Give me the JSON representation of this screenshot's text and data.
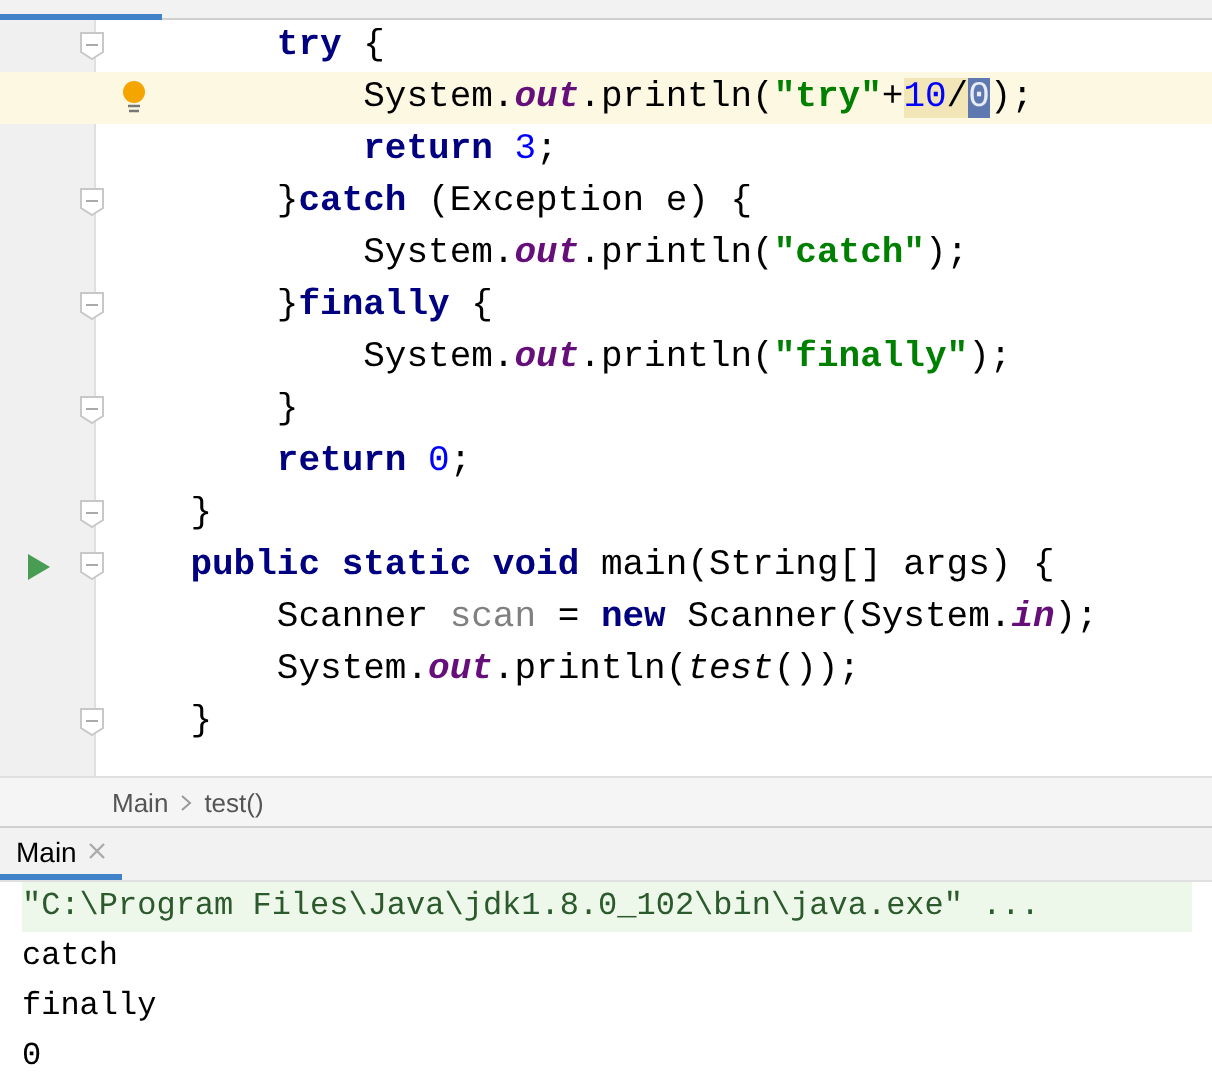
{
  "editor": {
    "lines": [
      {
        "fold": true,
        "current": false,
        "bulb": false,
        "run": false,
        "tokens": [
          {
            "kind": "keyword",
            "text": "        try"
          },
          {
            "kind": "plain",
            "text": " {"
          }
        ]
      },
      {
        "fold": false,
        "current": true,
        "bulb": true,
        "run": false,
        "tokens": [
          {
            "kind": "plain",
            "text": "            System."
          },
          {
            "kind": "field",
            "text": "out"
          },
          {
            "kind": "plain",
            "text": ".println("
          },
          {
            "kind": "string",
            "text": "\"try\""
          },
          {
            "kind": "plain",
            "text": "+"
          },
          {
            "kind": "usagenumber",
            "text": "10"
          },
          {
            "kind": "usageplain",
            "text": "/"
          },
          {
            "kind": "selectednumber",
            "text": "0"
          },
          {
            "kind": "plain",
            "text": ");"
          }
        ]
      },
      {
        "fold": false,
        "current": false,
        "bulb": false,
        "run": false,
        "tokens": [
          {
            "kind": "keyword",
            "text": "            return"
          },
          {
            "kind": "number",
            "text": " 3"
          },
          {
            "kind": "plain",
            "text": ";"
          }
        ]
      },
      {
        "fold": true,
        "current": false,
        "bulb": false,
        "run": false,
        "tokens": [
          {
            "kind": "plain",
            "text": "        }"
          },
          {
            "kind": "keyword",
            "text": "catch"
          },
          {
            "kind": "plain",
            "text": " (Exception e) {"
          }
        ]
      },
      {
        "fold": false,
        "current": false,
        "bulb": false,
        "run": false,
        "tokens": [
          {
            "kind": "plain",
            "text": "            System."
          },
          {
            "kind": "field",
            "text": "out"
          },
          {
            "kind": "plain",
            "text": ".println("
          },
          {
            "kind": "string",
            "text": "\"catch\""
          },
          {
            "kind": "plain",
            "text": ");"
          }
        ]
      },
      {
        "fold": true,
        "current": false,
        "bulb": false,
        "run": false,
        "tokens": [
          {
            "kind": "plain",
            "text": "        }"
          },
          {
            "kind": "keyword",
            "text": "finally"
          },
          {
            "kind": "plain",
            "text": " {"
          }
        ]
      },
      {
        "fold": false,
        "current": false,
        "bulb": false,
        "run": false,
        "tokens": [
          {
            "kind": "plain",
            "text": "            System."
          },
          {
            "kind": "field",
            "text": "out"
          },
          {
            "kind": "plain",
            "text": ".println("
          },
          {
            "kind": "string",
            "text": "\"finally\""
          },
          {
            "kind": "plain",
            "text": ");"
          }
        ]
      },
      {
        "fold": true,
        "current": false,
        "bulb": false,
        "run": false,
        "tokens": [
          {
            "kind": "plain",
            "text": "        }"
          }
        ]
      },
      {
        "fold": false,
        "current": false,
        "bulb": false,
        "run": false,
        "tokens": [
          {
            "kind": "keyword",
            "text": "        return"
          },
          {
            "kind": "number",
            "text": " 0"
          },
          {
            "kind": "plain",
            "text": ";"
          }
        ]
      },
      {
        "fold": true,
        "current": false,
        "bulb": false,
        "run": false,
        "tokens": [
          {
            "kind": "plain",
            "text": "    }"
          }
        ]
      },
      {
        "fold": true,
        "current": false,
        "bulb": false,
        "run": true,
        "tokens": [
          {
            "kind": "keyword",
            "text": "    public static void"
          },
          {
            "kind": "plain",
            "text": " main(String[] args) {"
          }
        ]
      },
      {
        "fold": false,
        "current": false,
        "bulb": false,
        "run": false,
        "tokens": [
          {
            "kind": "plain",
            "text": "        Scanner "
          },
          {
            "kind": "unused",
            "text": "scan"
          },
          {
            "kind": "plain",
            "text": " = "
          },
          {
            "kind": "keyword",
            "text": "new"
          },
          {
            "kind": "plain",
            "text": " Scanner(System."
          },
          {
            "kind": "field",
            "text": "in"
          },
          {
            "kind": "plain",
            "text": ");"
          }
        ]
      },
      {
        "fold": false,
        "current": false,
        "bulb": false,
        "run": false,
        "tokens": [
          {
            "kind": "plain",
            "text": "        System."
          },
          {
            "kind": "field",
            "text": "out"
          },
          {
            "kind": "plain",
            "text": ".println("
          },
          {
            "kind": "call",
            "text": "test"
          },
          {
            "kind": "plain",
            "text": "());"
          }
        ]
      },
      {
        "fold": true,
        "current": false,
        "bulb": false,
        "run": false,
        "tokens": [
          {
            "kind": "plain",
            "text": "    }"
          }
        ]
      }
    ]
  },
  "breadcrumbs": [
    "Main",
    "test()"
  ],
  "console": {
    "tabs": [
      {
        "label": "Main",
        "selected": true
      }
    ],
    "lines": [
      {
        "kind": "command",
        "text": "\"C:\\Program Files\\Java\\jdk1.8.0_102\\bin\\java.exe\" ..."
      },
      {
        "kind": "output",
        "text": "catch"
      },
      {
        "kind": "output",
        "text": "finally"
      },
      {
        "kind": "output",
        "text": "0"
      }
    ]
  }
}
